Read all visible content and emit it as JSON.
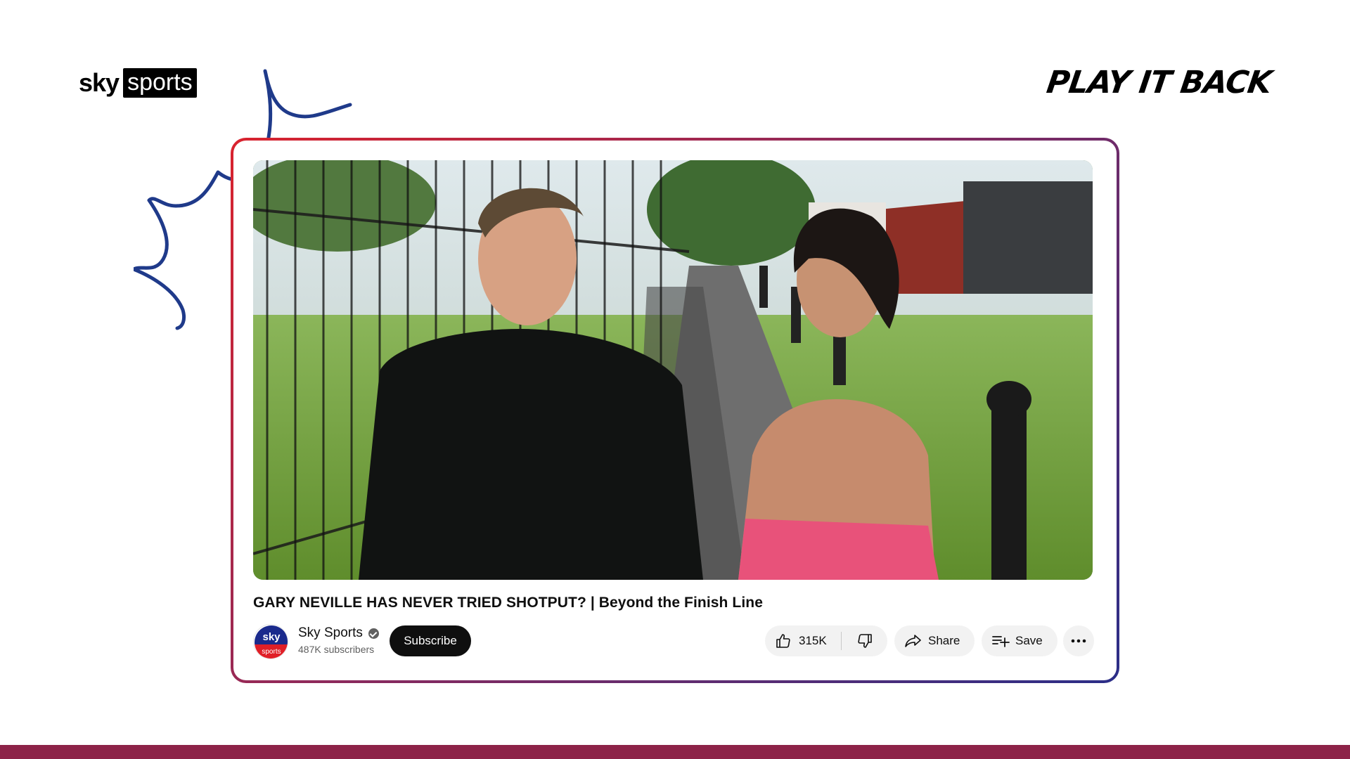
{
  "brand": {
    "sky_logo_word1": "sky",
    "sky_logo_word2": "sports",
    "wordmark": "PLAY IT BACK"
  },
  "colors": {
    "border_gradient": [
      "#d9232e",
      "#8d2a5c",
      "#2b2e88"
    ],
    "bottom_band": "#8d2348",
    "scribble": "#1f3a8a"
  },
  "video": {
    "title": "GARY NEVILLE HAS NEVER TRIED SHOTPUT? | Beyond the Finish Line",
    "thumbnail_icon": "video-thumbnail"
  },
  "channel": {
    "name": "Sky Sports",
    "subscribers": "487K subscribers",
    "avatar_top": "sky",
    "avatar_bottom": "sports",
    "verified_icon": "verified-check-icon"
  },
  "actions": {
    "subscribe": "Subscribe",
    "like_count": "315K",
    "share": "Share",
    "save": "Save",
    "icons": [
      "thumbs-up-icon",
      "thumbs-down-icon",
      "share-icon",
      "playlist-add-icon",
      "more-horizontal-icon"
    ]
  }
}
